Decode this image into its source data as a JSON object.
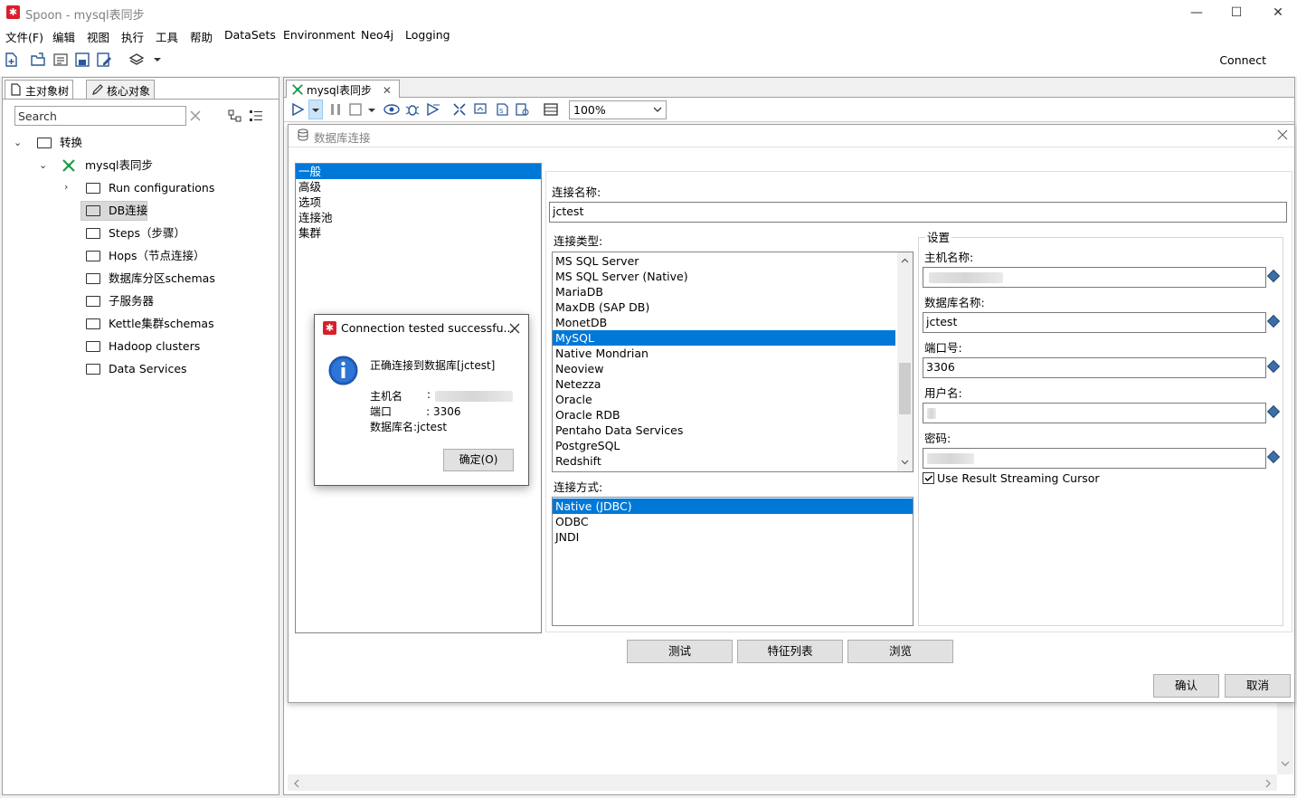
{
  "window": {
    "title": "Spoon - mysql表同步",
    "app_icon": "spoon-icon",
    "controls": [
      "—",
      "☐",
      "✕"
    ]
  },
  "menu": [
    "文件(F)",
    "编辑",
    "视图",
    "执行",
    "工具",
    "帮助",
    "DataSets",
    "Environment",
    "Neo4j",
    "Logging"
  ],
  "toolbar": {
    "connect_label": "Connect"
  },
  "left_panel": {
    "tabs": [
      "主对象树",
      "核心对象"
    ],
    "search": {
      "placeholder": "Search",
      "value": "Search"
    },
    "tree": {
      "root": "转换",
      "transform": "mysql表同步",
      "items": [
        "Run configurations",
        "DB连接",
        "Steps（步骤）",
        "Hops（节点连接）",
        "数据库分区schemas",
        "子服务器",
        "Kettle集群schemas",
        "Hadoop clusters",
        "Data Services"
      ]
    }
  },
  "editor": {
    "tab_label": "mysql表同步",
    "zoom": "100%"
  },
  "db_dialog": {
    "title": "数据库连接",
    "nav": [
      "一般",
      "高级",
      "选项",
      "连接池",
      "集群"
    ],
    "conn_name_label": "连接名称:",
    "conn_name_value": "jctest",
    "conn_type_label": "连接类型:",
    "conn_types": [
      "MS SQL Server",
      "MS SQL Server (Native)",
      "MariaDB",
      "MaxDB (SAP DB)",
      "MonetDB",
      "MySQL",
      "Native Mondrian",
      "Neoview",
      "Netezza",
      "Oracle",
      "Oracle RDB",
      "Pentaho Data Services",
      "PostgreSQL",
      "Redshift"
    ],
    "conn_method_label": "连接方式:",
    "conn_methods": [
      "Native (JDBC)",
      "ODBC",
      "JNDI"
    ],
    "settings_label": "设置",
    "host_label": "主机名称:",
    "host_value": "",
    "dbname_label": "数据库名称:",
    "dbname_value": "jctest",
    "port_label": "端口号:",
    "port_value": "3306",
    "user_label": "用户名:",
    "user_value": "",
    "password_label": "密码:",
    "password_value": "",
    "streaming_label": "Use Result Streaming Cursor",
    "buttons": {
      "test": "测试",
      "features": "特征列表",
      "browse": "浏览",
      "ok": "确认",
      "cancel": "取消"
    }
  },
  "popup": {
    "title": "Connection tested successfu...",
    "message": "正确连接到数据库[jctest]",
    "host_label": "主机名",
    "host_sep": ":",
    "port_line": "端口          : 3306",
    "db_line": "数据库名:jctest",
    "ok_button": "确定(O)"
  },
  "colors": {
    "selection": "#0078d7",
    "brand": "#d9202a",
    "green": "#1e9c4b"
  }
}
